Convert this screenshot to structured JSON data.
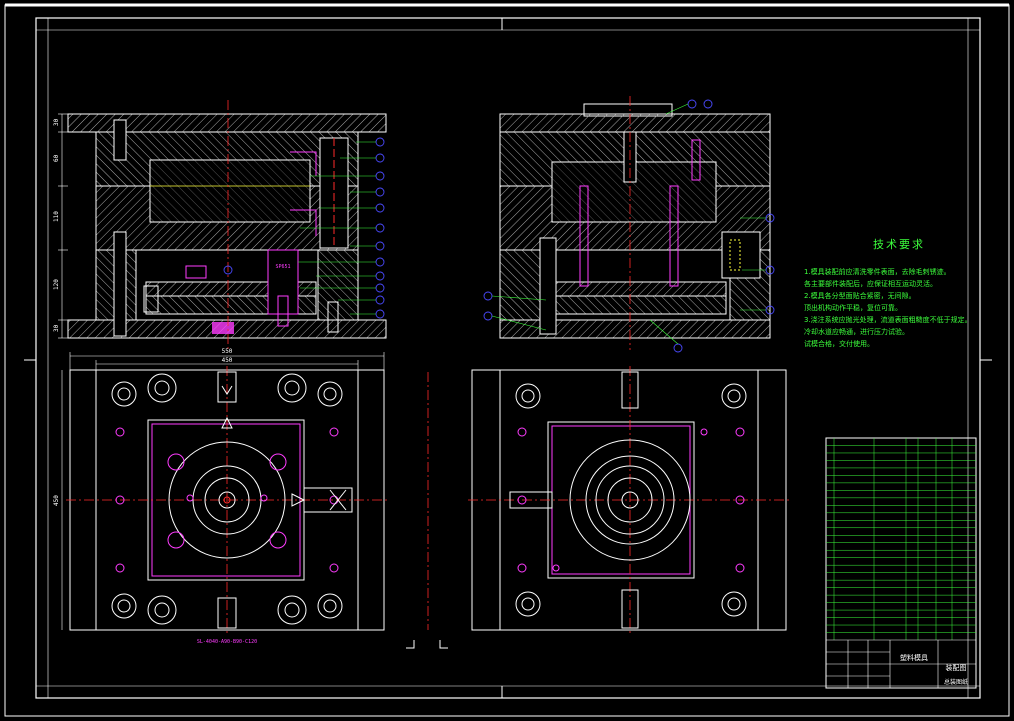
{
  "drawing": {
    "background": "#000000",
    "colors": {
      "outline": "#ffffff",
      "hatch": "#bfbfbf",
      "center": "#ff2a2a",
      "magenta": "#ff3cff",
      "green": "#3cff3c",
      "blue": "#4a4aff",
      "cyan": "#3cffff",
      "yellow": "#ffff3c"
    },
    "dimensions": {
      "overall_width": "550",
      "inner_width": "450",
      "side_height": "450",
      "left_stack": [
        "30",
        "60",
        "110",
        "120",
        "30"
      ]
    },
    "bottom_note": "SL-4040-A90-B90-C120",
    "label_block": "SP651"
  },
  "technical_requirements": {
    "title": "技术要求",
    "lines": [
      "1.模具装配前应清洗零件表面，去除毛刺锈迹。",
      "各主要部件装配后，应保证相互运动灵活。",
      "2.模具各分型面贴合紧密，无间隙。",
      "顶出机构动作平稳，复位可靠。",
      "3.浇注系统应抛光处理，流道表面粗糙度不低于规定。",
      "冷却水道应畅通，进行压力试验。",
      "试模合格，交付使用。"
    ]
  },
  "title_block": {
    "cells": [
      "塑料模具",
      "装配图",
      "总装图纸"
    ]
  }
}
